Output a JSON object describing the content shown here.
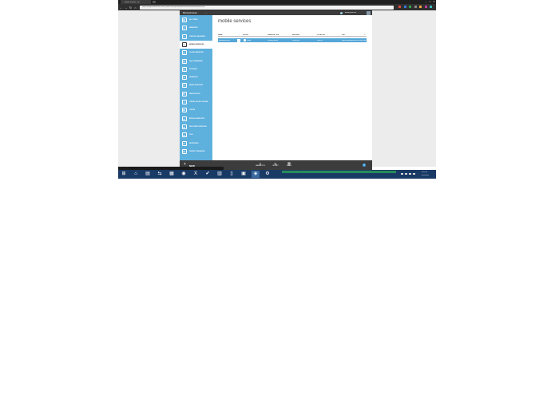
{
  "browser": {
    "tab_title": "Mobile Services - Wi...",
    "address": "https://manage.windowsazure.com/@admin#Workspaces/MobileServicesExtension/mobileservices",
    "minimize": "–",
    "maximize": "□",
    "close": "✕",
    "nav": {
      "back": "←",
      "forward": "→",
      "reload": "↻",
      "home": "⌂"
    },
    "extension_colors": [
      "#e04a3a",
      "#3a7ae0",
      "#2ea84a",
      "#8a8a8a",
      "#f2a83a",
      "#c03a9a",
      "#3ac0c0"
    ]
  },
  "portal": {
    "brand": "Microsoft Azure",
    "brand_chevron": "⌄",
    "user": "demo@live.com",
    "sidebar": [
      {
        "label": "ALL ITEMS",
        "icon": "▦"
      },
      {
        "label": "WEBSITES",
        "icon": "◎"
      },
      {
        "label": "VIRTUAL MACHINES",
        "icon": "▭"
      },
      {
        "label": "MOBILE SERVICES",
        "icon": "▯",
        "active": true
      },
      {
        "label": "CLOUD SERVICES",
        "icon": "☁"
      },
      {
        "label": "SQL DATABASES",
        "icon": "▤"
      },
      {
        "label": "STORAGE",
        "icon": "▥"
      },
      {
        "label": "HDINSIGHT",
        "icon": "♣"
      },
      {
        "label": "MEDIA SERVICES",
        "icon": "⚙"
      },
      {
        "label": "SERVICE BUS",
        "icon": "⇄"
      },
      {
        "label": "VISUAL STUDIO ONLINE",
        "icon": "◁"
      },
      {
        "label": "CACHE",
        "icon": "▣"
      },
      {
        "label": "BIZTALK SERVICES",
        "icon": "☁"
      },
      {
        "label": "RECOVERY SERVICES",
        "icon": "☁"
      },
      {
        "label": "CDN",
        "icon": "☁"
      },
      {
        "label": "NETWORKS",
        "icon": "⊕"
      },
      {
        "label": "TRAFFIC MANAGER",
        "icon": "◉"
      }
    ],
    "page_title": "mobile services",
    "table": {
      "columns": [
        "NAME",
        "STATUS",
        "SUBSCRIPTION",
        "BACKEND",
        "LOCATION",
        "URL"
      ],
      "rows": [
        {
          "name": "mymobileservice",
          "status": "Ready",
          "subscription": "Windows Azure",
          "backend": "JavaScript",
          "location": "West US",
          "url": "https://mymobileservice.azure-mobile.net/"
        }
      ],
      "search_icon": "⌕"
    },
    "commands": {
      "new_label": "NEW",
      "new_icon": "+",
      "items": [
        {
          "label": "MANAGE KEYS",
          "icon": "ℹ"
        },
        {
          "label": "RESTART",
          "icon": "↻"
        },
        {
          "label": "DELETE",
          "icon": "🗑"
        }
      ],
      "help": "?"
    }
  },
  "tooltip_text": "https://manage.windowsazure.com/@admin#Workspaces/MobileServicesExtension/mobileservices",
  "taskbar": {
    "icons": [
      "⊞",
      "⌂",
      "▤",
      "⇆",
      "▦",
      "◉",
      "X",
      "✔",
      "▥",
      "▯",
      "▣",
      "◈",
      "⚙"
    ],
    "tray_text": "Microsoft Azure - Google Chrome",
    "time": "3:45 PM",
    "date": "4/22/2014"
  }
}
